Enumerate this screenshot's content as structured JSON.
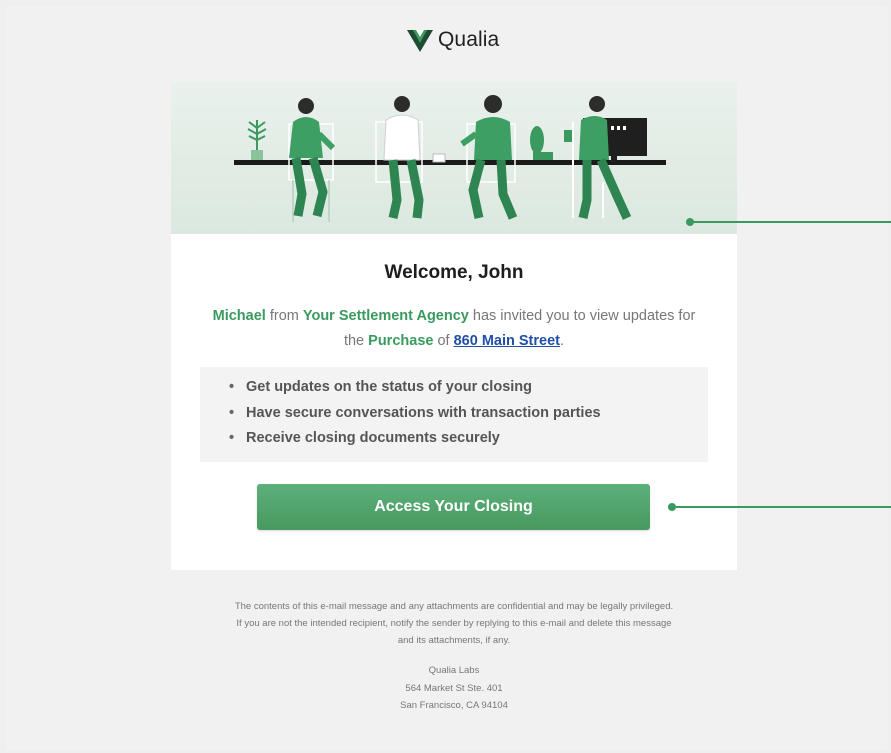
{
  "brand": {
    "name": "Qualia",
    "accent": "#3a9a5e",
    "logo_mark_color": "#1f4a33"
  },
  "email": {
    "welcome": "Welcome, John",
    "invite": {
      "sender": "Michael",
      "from_text": " from ",
      "agency": "Your Settlement Agency",
      "mid_text": " has invited you to view updates for the ",
      "transaction_type": "Purchase",
      "of_text": " of ",
      "property": "860 Main Street",
      "end_text": "."
    },
    "features": [
      "Get updates on the status of your closing",
      "Have secure conversations with transaction parties",
      "Receive closing documents securely"
    ],
    "cta_label": "Access Your Closing"
  },
  "footer": {
    "disclaimer_1": "The contents of this e-mail message and any attachments are confidential and may be legally privileged.",
    "disclaimer_2": "If you are not the intended recipient, notify the sender by replying to this e-mail and delete this message",
    "disclaimer_3": "and its attachments, if any.",
    "company": "Qualia Labs",
    "street": "564 Market St Ste. 401",
    "city": "San Francisco, CA 94104"
  }
}
